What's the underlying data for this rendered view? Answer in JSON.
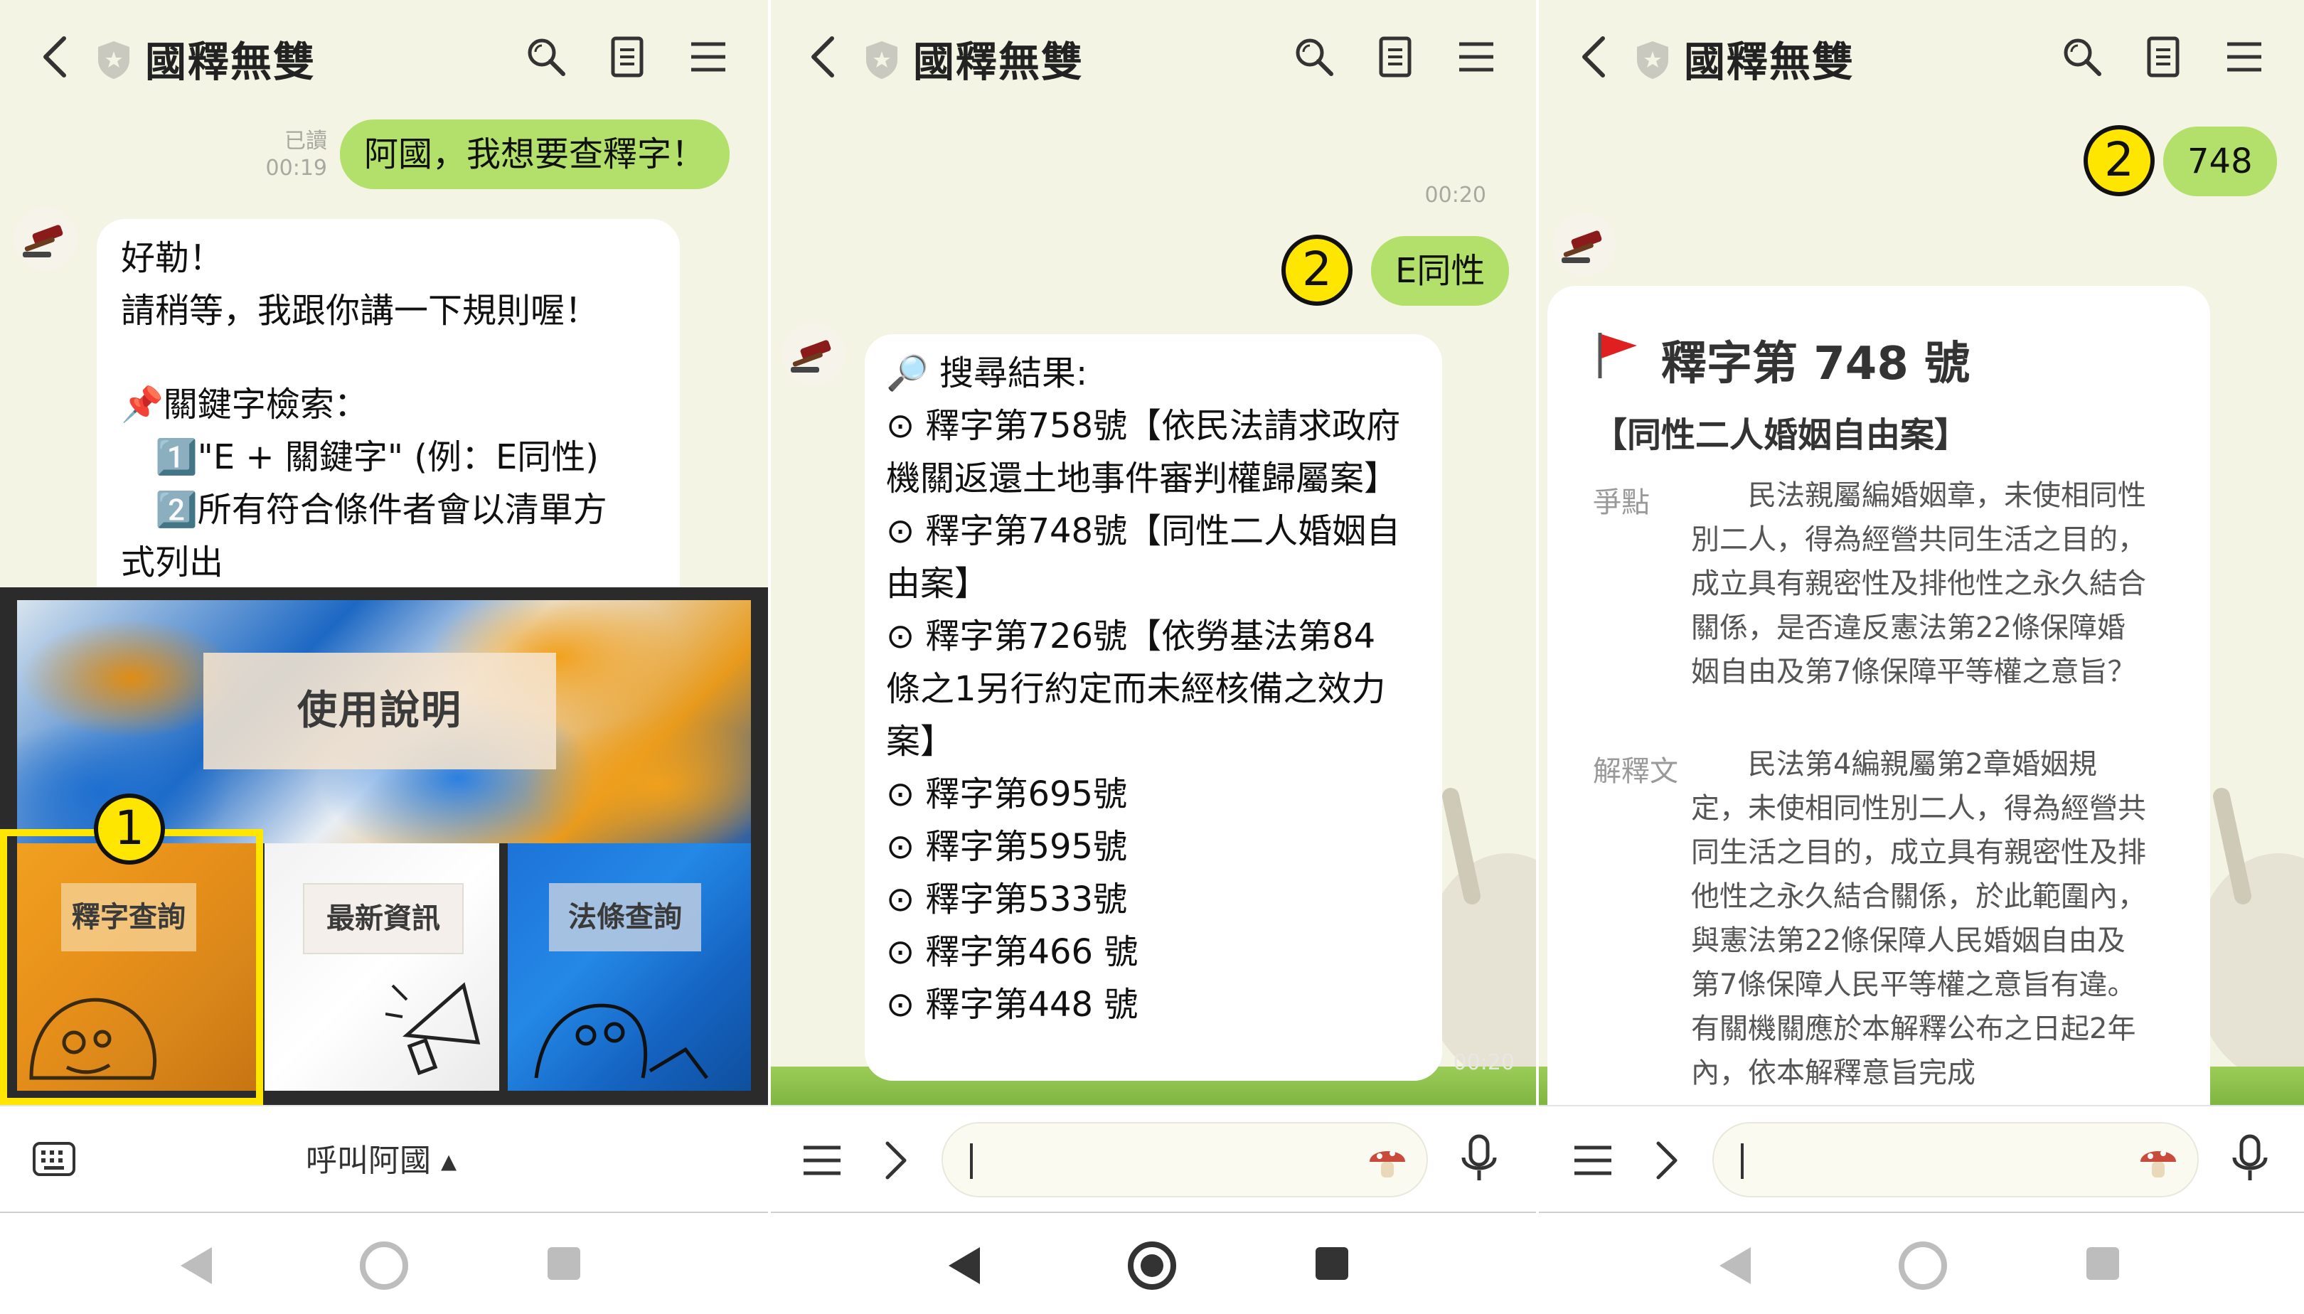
{
  "app": {
    "title": "國釋無雙"
  },
  "panel1": {
    "user_message": {
      "text": "阿國，我想要查釋字！",
      "read_label": "已讀",
      "time": "00:19"
    },
    "bot_message": {
      "lines": [
        "好勒！",
        "請稍等，我跟你講一下規則喔！",
        "",
        "📌關鍵字檢索：",
        "　1️⃣\"E + 關鍵字\" (例：E同性)",
        "　2️⃣所有符合條件者會以清單方",
        "式列出"
      ]
    },
    "rich_menu": {
      "banner_label": "使用說明",
      "buttons": [
        "釋字查詢",
        "最新資訊",
        "法條查詢"
      ],
      "highlight_badge": "1"
    },
    "bottom": {
      "menu_label": "呼叫阿國 ▴"
    }
  },
  "panel2": {
    "time": "00:20",
    "user_message": {
      "text": "E同性"
    },
    "badge": "2",
    "results": {
      "header": "🔎 搜尋結果:",
      "lines": [
        "⊙ 釋字第758號【依民法請求政府",
        "機關返還土地事件審判權歸屬案】",
        "⊙ 釋字第748號【同性二人婚姻自",
        "由案】",
        "⊙ 釋字第726號【依勞基法第84",
        "條之1另行約定而未經核備之效力",
        "案】",
        "⊙ 釋字第695號",
        "⊙ 釋字第595號",
        "⊙ 釋字第533號",
        "⊙ 釋字第466 號",
        "⊙ 釋字第448 號"
      ]
    },
    "faded_time": "00:20"
  },
  "panel3": {
    "user_message": {
      "text": "748"
    },
    "badge": "2",
    "card": {
      "title": "釋字第 748 號",
      "subtitle": "【同性二人婚姻自由案】",
      "issue_label": "爭點",
      "issue_text": "　　民法親屬編婚姻章，未使相同性別二人，得為經營共同生活之目的，成立具有親密性及排他性之永久結合關係，是否違反憲法第22條保障婚姻自由及第7條保障平等權之意旨？",
      "holding_label": "解釋文",
      "holding_text": "　　民法第4編親屬第2章婚姻規定，未使相同性別二人，得為經營共同生活之目的，成立具有親密性及排他性之永久結合關係，於此範圍內，與憲法第22條保障人民婚姻自由及第7條保障人民平等權之意旨有違。有關機關應於本解釋公布之日起2年內，依本解釋意旨完成"
    }
  },
  "icons": {
    "header": [
      "back-icon",
      "shield-icon",
      "search-icon",
      "note-icon",
      "menu-icon"
    ],
    "bottom": [
      "keyboard-icon",
      "hamburger-icon",
      "chevron-right-icon",
      "mushroom-icon",
      "mic-icon"
    ],
    "nav": [
      "nav-back-icon",
      "nav-home-icon",
      "nav-recent-icon"
    ]
  },
  "colors": {
    "chat_bg": "#f4f4e4",
    "user_bubble": "#b2e06a",
    "bot_bubble": "#ffffff",
    "highlight": "#ffe600",
    "flag": "#e02020"
  }
}
